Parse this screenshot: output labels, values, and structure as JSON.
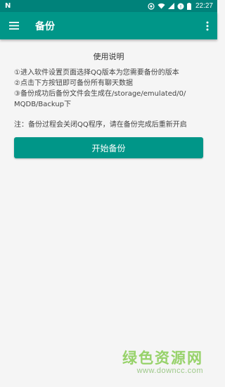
{
  "status_bar": {
    "logo": "N",
    "time": "22:27",
    "icons": [
      "sync-icon",
      "wifi-icon",
      "signal-icon",
      "no-sim-icon",
      "battery-icon"
    ],
    "color": "#00827a"
  },
  "app_bar": {
    "title": "备份",
    "menu_icon": "hamburger-menu-icon",
    "overflow_icon": "more-vert-icon",
    "color": "#009688"
  },
  "instructions": {
    "title": "使用说明",
    "lines": [
      "①进入软件设置页面选择QQ版本为您需要备份的版本",
      "②点击下方按钮即可备份所有聊天数据",
      "③备份成功后备份文件会生成在/storage/emulated/0/",
      "MQDB/Backup下"
    ]
  },
  "note": "注：备份过程会关闭QQ程序，请在备份完成后重新开启",
  "start_button_label": "开始备份",
  "watermark": {
    "text": "绿色资源网",
    "url": "www.downcc.com"
  }
}
